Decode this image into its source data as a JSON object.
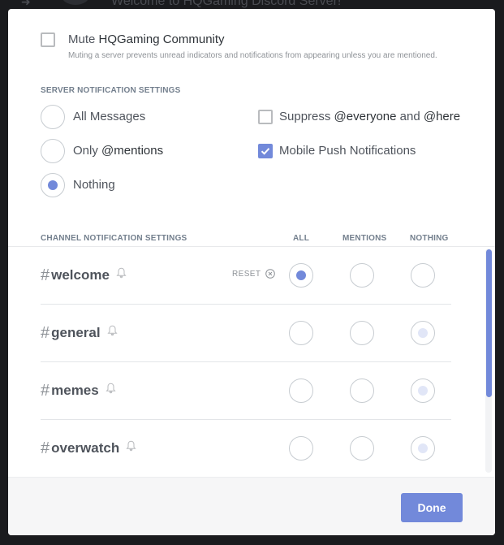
{
  "background": {
    "title": "Welcome to HQGaming Discord Server!"
  },
  "mute": {
    "label_prefix": "Mute ",
    "server_name": "HQGaming Community",
    "checked": false,
    "description": "Muting a server prevents unread indicators and notifications from appearing unless you are mentioned."
  },
  "server_settings": {
    "heading": "SERVER NOTIFICATION SETTINGS",
    "options": [
      {
        "label": "All Messages",
        "selected": false
      },
      {
        "label_prefix": "Only ",
        "label_strong": "@mentions",
        "selected": false
      },
      {
        "label": "Nothing",
        "selected": true
      }
    ],
    "suppress": {
      "prefix": "Suppress ",
      "everyone": "@everyone",
      "middle": " and ",
      "here": "@here",
      "checked": false
    },
    "mobile_push": {
      "label": "Mobile Push Notifications",
      "checked": true
    }
  },
  "channel_settings": {
    "heading": "CHANNEL NOTIFICATION SETTINGS",
    "columns": [
      "ALL",
      "MENTIONS",
      "NOTHING"
    ],
    "reset_label": "RESET",
    "channels": [
      {
        "hash": "#",
        "name": "welcome",
        "selected": "ALL",
        "overridden": true
      },
      {
        "hash": "#",
        "name": "general",
        "selected": "NOTHING",
        "overridden": false
      },
      {
        "hash": "#",
        "name": "memes",
        "selected": "NOTHING",
        "overridden": false
      },
      {
        "hash": "#",
        "name": "overwatch",
        "selected": "NOTHING",
        "overridden": false
      }
    ]
  },
  "footer": {
    "done_label": "Done"
  },
  "colors": {
    "accent": "#7289da",
    "faint_accent": "#e1e6f7"
  }
}
